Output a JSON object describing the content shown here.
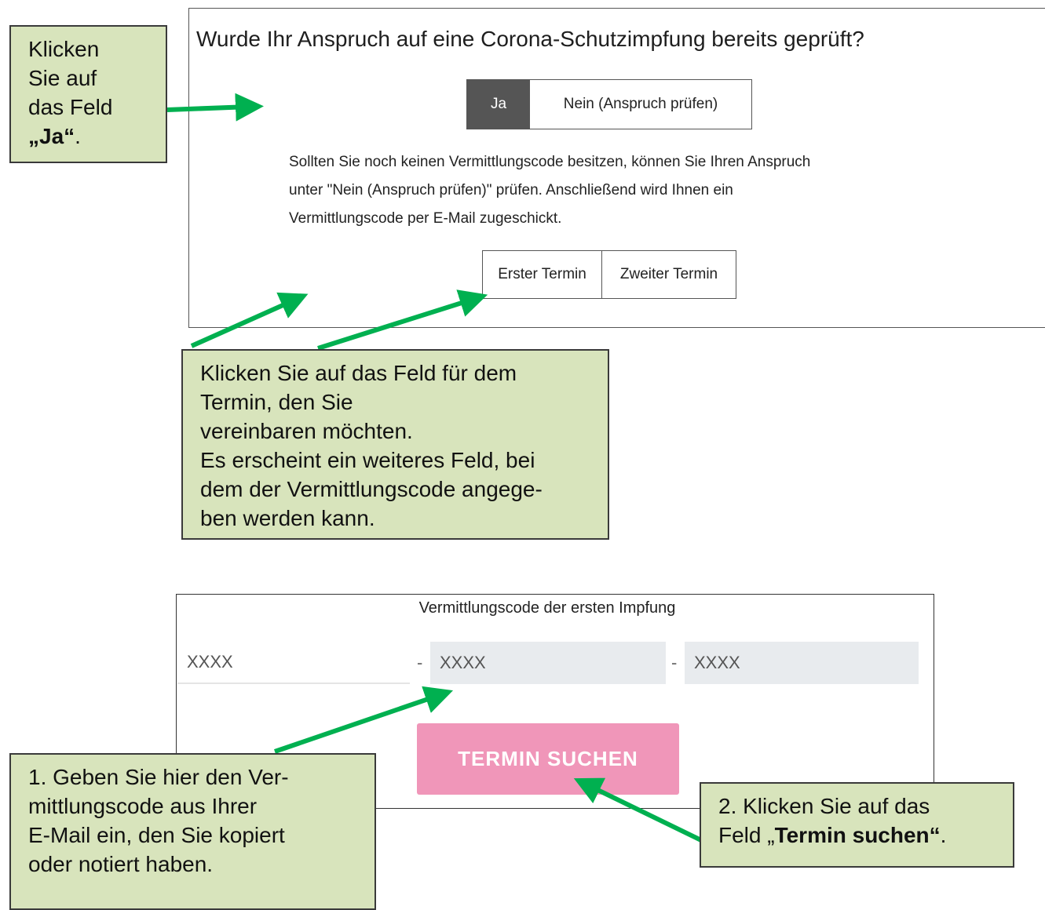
{
  "question": "Wurde Ihr Anspruch auf eine Corona-Schutzimpfung bereits geprüft?",
  "toggle_yesno": {
    "yes": "Ja",
    "no": "Nein (Anspruch prüfen)"
  },
  "info_text": [
    "Sollten Sie noch keinen Vermittlungscode besitzen, können Sie Ihren Anspruch",
    "unter \"Nein (Anspruch prüfen)\" prüfen. Anschließend wird Ihnen ein",
    "Vermittlungscode per E-Mail zugeschickt."
  ],
  "toggle_termin": {
    "first": "Erster Termin",
    "second": "Zweiter Termin"
  },
  "code_section": {
    "label": "Vermittlungscode der ersten Impfung",
    "placeholders": [
      "XXXX",
      "XXXX",
      "XXXX"
    ],
    "separator": "-",
    "search_button": "TERMIN SUCHEN"
  },
  "callouts": {
    "ja": {
      "line1": "Klicken",
      "line2": "Sie auf",
      "line3": "das Feld",
      "bold": "„Ja“",
      "suffix": "."
    },
    "termin": [
      "Klicken Sie auf das Feld für dem",
      "Termin, den Sie",
      "vereinbaren möchten.",
      "Es erscheint ein weiteres Feld, bei",
      "dem der Vermittlungscode angege-",
      "ben werden kann."
    ],
    "code": [
      "1. Geben Sie hier den Ver-",
      "mittlungscode aus Ihrer",
      "E-Mail ein, den Sie kopiert",
      "oder notiert haben."
    ],
    "search": {
      "line1": "2. Klicken Sie auf das",
      "prefix": "Feld „",
      "bold": "Termin suchen“",
      "suffix": "."
    }
  },
  "colors": {
    "callout_bg": "#d8e4bc",
    "arrow": "#00b050",
    "search_button": "#f096b9",
    "selected_toggle": "#555555"
  }
}
